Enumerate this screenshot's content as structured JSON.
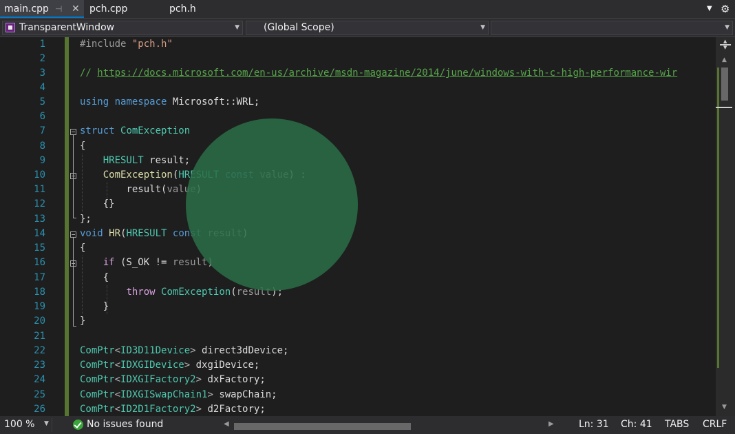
{
  "tabs": [
    {
      "label": "main.cpp",
      "active": true
    },
    {
      "label": "pch.cpp",
      "active": false
    },
    {
      "label": "pch.h",
      "active": false
    }
  ],
  "tab_icons": {
    "pin": "pin-icon",
    "close": "close-icon",
    "overflow": "chevron-down-icon",
    "settings": "gear-icon"
  },
  "navbar": {
    "project": "TransparentWindow",
    "scope": "(Global Scope)",
    "member": ""
  },
  "editor": {
    "line_numbers": [
      "1",
      "2",
      "3",
      "4",
      "5",
      "6",
      "7",
      "8",
      "9",
      "10",
      "11",
      "12",
      "13",
      "14",
      "15",
      "16",
      "17",
      "18",
      "19",
      "20",
      "21",
      "22",
      "23",
      "24",
      "25",
      "26"
    ],
    "include_kw": "#include",
    "include_file": "\"pch.h\"",
    "comment_prefix": "// ",
    "comment_url": "https://docs.microsoft.com/en-us/archive/msdn-magazine/2014/june/windows-with-c-high-performance-wir",
    "using_line": {
      "kw1": "using",
      "kw2": "namespace",
      "rest": " Microsoft::WRL;"
    },
    "struct_line": {
      "kw": "struct",
      "name": "ComException"
    },
    "open_brace": "{",
    "close_brace": "}",
    "close_struct": "};",
    "member_line": {
      "type": "HRESULT",
      "rest": " result;"
    },
    "ctor_line": {
      "name": "ComException",
      "p1": "(",
      "type": "HRESULT",
      "kw": "const",
      "param": "value",
      "p2": ") :"
    },
    "init_line": {
      "member": "result",
      "p1": "(",
      "param": "value",
      "p2": ")"
    },
    "empty_body": "{}",
    "hr_line": {
      "kw": "void",
      "name": "HR",
      "p1": "(",
      "type": "HRESULT",
      "kw2": "const",
      "param": "result",
      "p2": ")"
    },
    "if_line": {
      "kw": "if",
      "p1": " (S_OK != ",
      "param": "result",
      "p2": ")"
    },
    "throw_line": {
      "kw": "throw",
      "type": "ComException",
      "p1": "(",
      "param": "result",
      "p2": ");"
    },
    "decls": [
      {
        "tmpl": "ComPtr",
        "arg": "ID3D11Device",
        "name": "direct3dDevice;"
      },
      {
        "tmpl": "ComPtr",
        "arg": "IDXGIDevice",
        "name": "dxgiDevice;"
      },
      {
        "tmpl": "ComPtr",
        "arg": "IDXGIFactory2",
        "name": "dxFactory;"
      },
      {
        "tmpl": "ComPtr",
        "arg": "IDXGISwapChain1",
        "name": "swapChain;"
      },
      {
        "tmpl": "ComPtr",
        "arg": "ID2D1Factory2",
        "name": "d2Factory;"
      }
    ]
  },
  "status": {
    "zoom": "100 %",
    "issues": "No issues found",
    "ln": "Ln: 31",
    "ch": "Ch: 41",
    "indent": "TABS",
    "eol": "CRLF"
  },
  "colors": {
    "background": "#1e1e1e",
    "keyword": "#569cd6",
    "type": "#4ec9b0",
    "function": "#dcdcaa",
    "string": "#d69d85",
    "comment": "#57a64a",
    "line_number": "#2b91af",
    "overlay_circle": "#2a6e46",
    "change_bar": "#577430",
    "tab_accent": "#007acc"
  }
}
